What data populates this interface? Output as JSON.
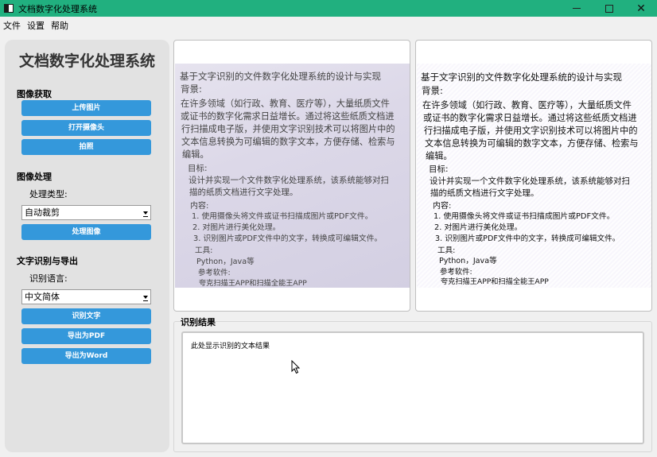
{
  "window": {
    "title": "文档数字化处理系统",
    "controls": {
      "minimize": "—",
      "maximize": "☐",
      "close": "✕"
    }
  },
  "menu": [
    "文件",
    "设置",
    "帮助"
  ],
  "sidebar": {
    "title": "文档数字化处理系统",
    "acquire": {
      "heading": "图像获取",
      "upload": "上传图片",
      "open_camera": "打开摄像头",
      "capture": "拍照"
    },
    "process": {
      "heading": "图像处理",
      "type_label": "处理类型:",
      "type_value": "自动裁剪",
      "process_button": "处理图像"
    },
    "ocr": {
      "heading": "文字识别与导出",
      "lang_label": "识别语言:",
      "lang_value": "中文简体",
      "recognize": "识别文字",
      "export_pdf": "导出为PDF",
      "export_word": "导出为Word"
    }
  },
  "document_lines": {
    "title": "基于文字识别的文件数字化处理系统的设计与实现",
    "bg_label": "背景:",
    "bg1": "在许多领域（如行政、教育、医疗等），大量纸质文件",
    "bg2": "或证书的数字化需求日益增长。通过将这些纸质文档进",
    "bg3": "行扫描成电子版，并使用文字识别技术可以将图片中的",
    "bg4": "文本信息转换为可编辑的数字文本，方便存储、检索与",
    "bg5": "编辑。",
    "goal_label": "目标:",
    "goal1": "设计并实现一个文件数字化处理系统，该系统能够对扫",
    "goal2": "描的纸质文档进行文字处理。",
    "content_label": "内容:",
    "c1": "1. 使用摄像头将文件或证书扫描成图片或PDF文件。",
    "c2": "2. 对图片进行美化处理。",
    "c3": "3. 识别图片或PDF文件中的文字，转换成可编辑文件。",
    "tools_label": "工具:",
    "tools": "Python，Java等",
    "ref_label": "参考软件:",
    "ref": "夸克扫描王APP和扫描全能王APP"
  },
  "result": {
    "label": "识别结果",
    "placeholder": "此处显示识别的文本结果"
  }
}
